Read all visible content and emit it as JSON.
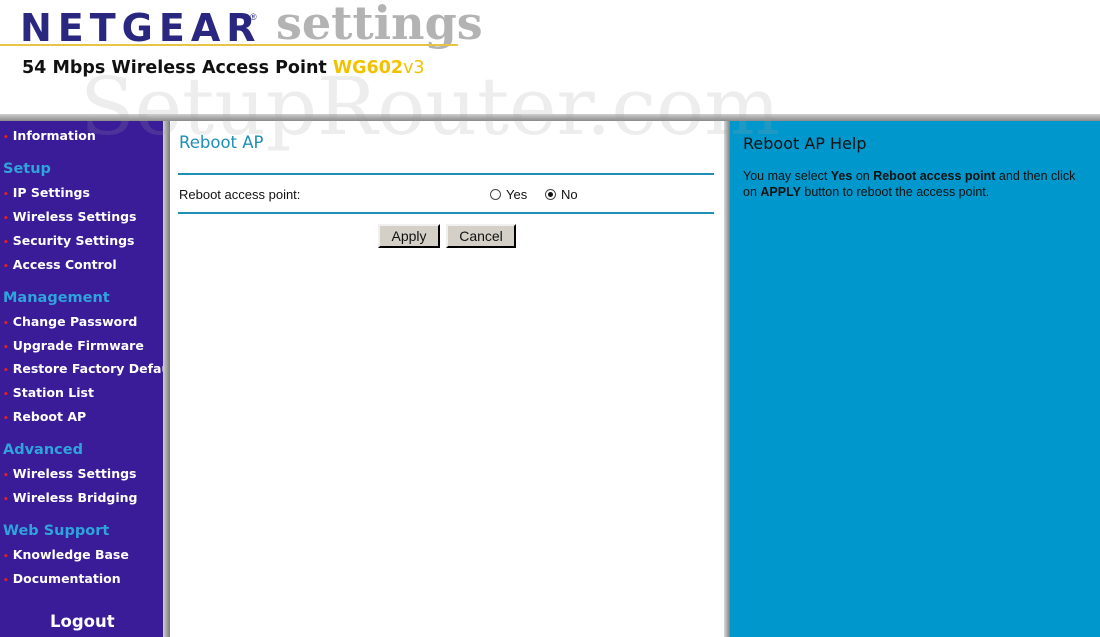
{
  "header": {
    "brand": "NETGEAR",
    "brand_mark": "®",
    "settings_word": "settings",
    "product_line": "54 Mbps Wireless Access Point ",
    "model": "WG602",
    "model_version": "v3",
    "watermark": "SetupRouter.com"
  },
  "sidebar": {
    "items": {
      "information": "Information",
      "ip_settings": "IP Settings",
      "wireless_settings": "Wireless Settings",
      "security_settings": "Security Settings",
      "access_control": "Access Control",
      "change_password": "Change Password",
      "upgrade_firmware": "Upgrade Firmware",
      "restore_factory_default": "Restore Factory Default",
      "station_list": "Station List",
      "reboot_ap": "Reboot AP",
      "adv_wireless_settings": "Wireless Settings",
      "wireless_bridging": "Wireless Bridging",
      "knowledge_base": "Knowledge Base",
      "documentation": "Documentation"
    },
    "headings": {
      "setup": "Setup",
      "management": "Management",
      "advanced": "Advanced",
      "web_support": "Web Support"
    },
    "logout": "Logout",
    "bullet": "•"
  },
  "main": {
    "title": "Reboot AP",
    "field_label": "Reboot access point:",
    "radio_yes": "Yes",
    "radio_no": "No",
    "selected": "No",
    "apply_label": "Apply",
    "cancel_label": "Cancel"
  },
  "help": {
    "title": "Reboot AP Help",
    "text_1": "You may select ",
    "text_yes": "Yes",
    "text_2": " on ",
    "text_reboot": "Reboot access point",
    "text_3": " and then click on ",
    "text_apply": "APPLY",
    "text_4": " button to reboot the access point."
  },
  "colors": {
    "sidebar_bg": "#3a1b98",
    "help_bg": "#0098cc",
    "accent": "#1f8fb8",
    "heading": "#2fa3dc",
    "bullet": "#e3221c",
    "brand": "#2a2780",
    "model": "#f2c200"
  }
}
